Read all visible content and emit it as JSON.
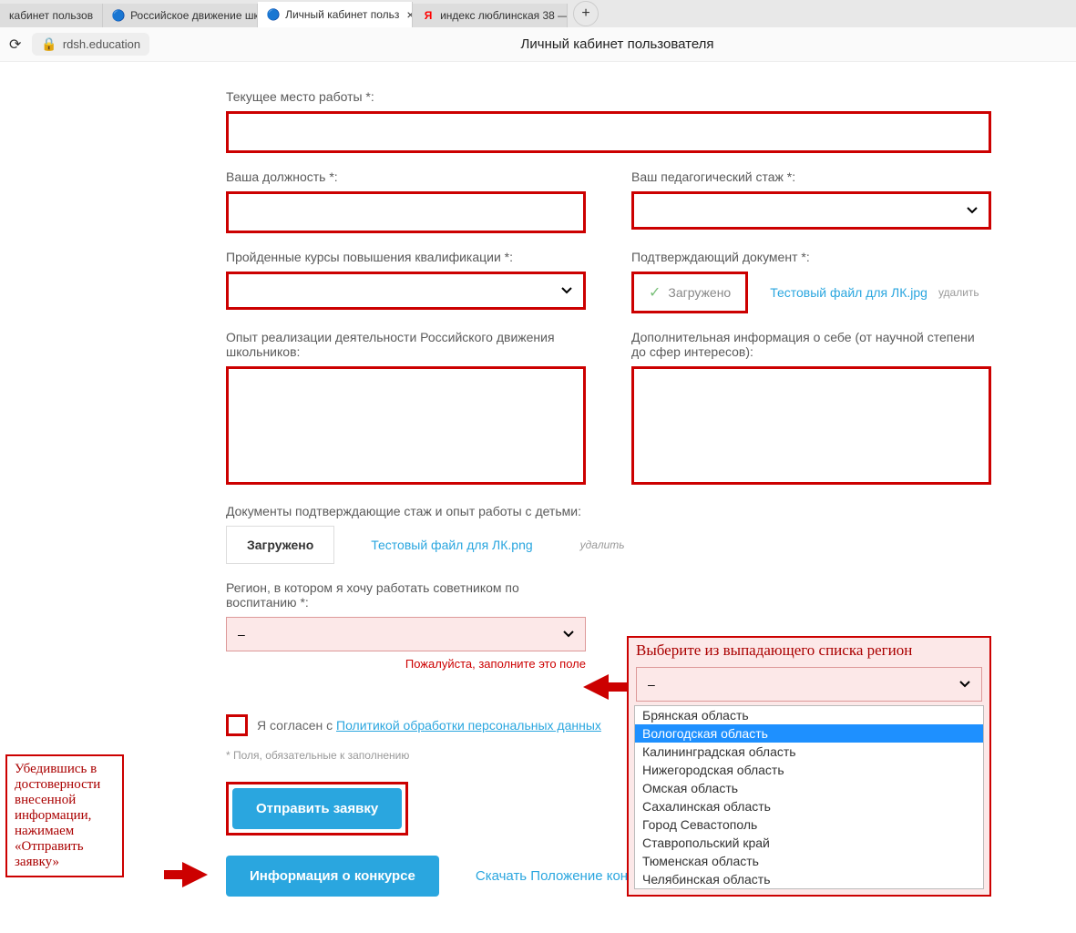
{
  "browser": {
    "tabs": [
      {
        "label": "кабинет пользов"
      },
      {
        "label": "Российское движение шк"
      },
      {
        "label": "Личный кабинет польз",
        "active": true
      },
      {
        "label": "индекс люблинская 38 —"
      }
    ],
    "url": "rdsh.education",
    "center_title": "Личный кабинет пользователя"
  },
  "form": {
    "workplace_label": "Текущее место работы *:",
    "position_label": "Ваша должность *:",
    "experience_label": "Ваш педагогический стаж *:",
    "courses_label": "Пройденные курсы повышения квалификации *:",
    "confirm_doc_label": "Подтверждающий документ *:",
    "uploaded_text": "Загружено",
    "confirm_file": "Тестовый файл для ЛК.jpg",
    "delete_text": "удалить",
    "rdsh_exp_label": "Опыт реализации деятельности Российского движения школьников:",
    "addinfo_label": "Дополнительная информация о себе (от научной степени до сфер интересов):",
    "docs_label": "Документы подтверждающие стаж и опыт работы с детьми:",
    "docs_uploaded": "Загружено",
    "docs_file": "Тестовый файл для ЛК.png",
    "region_label": "Регион, в котором я хочу работать советником по воспитанию *:",
    "region_value": "–",
    "region_error": "Пожалуйста, заполните это поле",
    "consent_prefix": "Я согласен с ",
    "consent_link": "Политикой обработки персональных данных",
    "req_note": "* Поля, обязательные к заполнению",
    "submit": "Отправить заявку",
    "info_btn": "Информация о конкурсе",
    "download_link": "Скачать Положение конкурса"
  },
  "annotations": {
    "dd_title": "Выберите из выпадающего списка регион",
    "dd_value": "–",
    "dd_items": [
      "Брянская область",
      "Вологодская область",
      "Калининградская область",
      "Нижегородская область",
      "Омская область",
      "Сахалинская область",
      "Город Севастополь",
      "Ставропольский край",
      "Тюменская область",
      "Челябинская область"
    ],
    "dd_highlight_index": 1,
    "note_box": "Убедившись в достоверности внесенной информации, нажимаем «Отправить заявку»"
  }
}
